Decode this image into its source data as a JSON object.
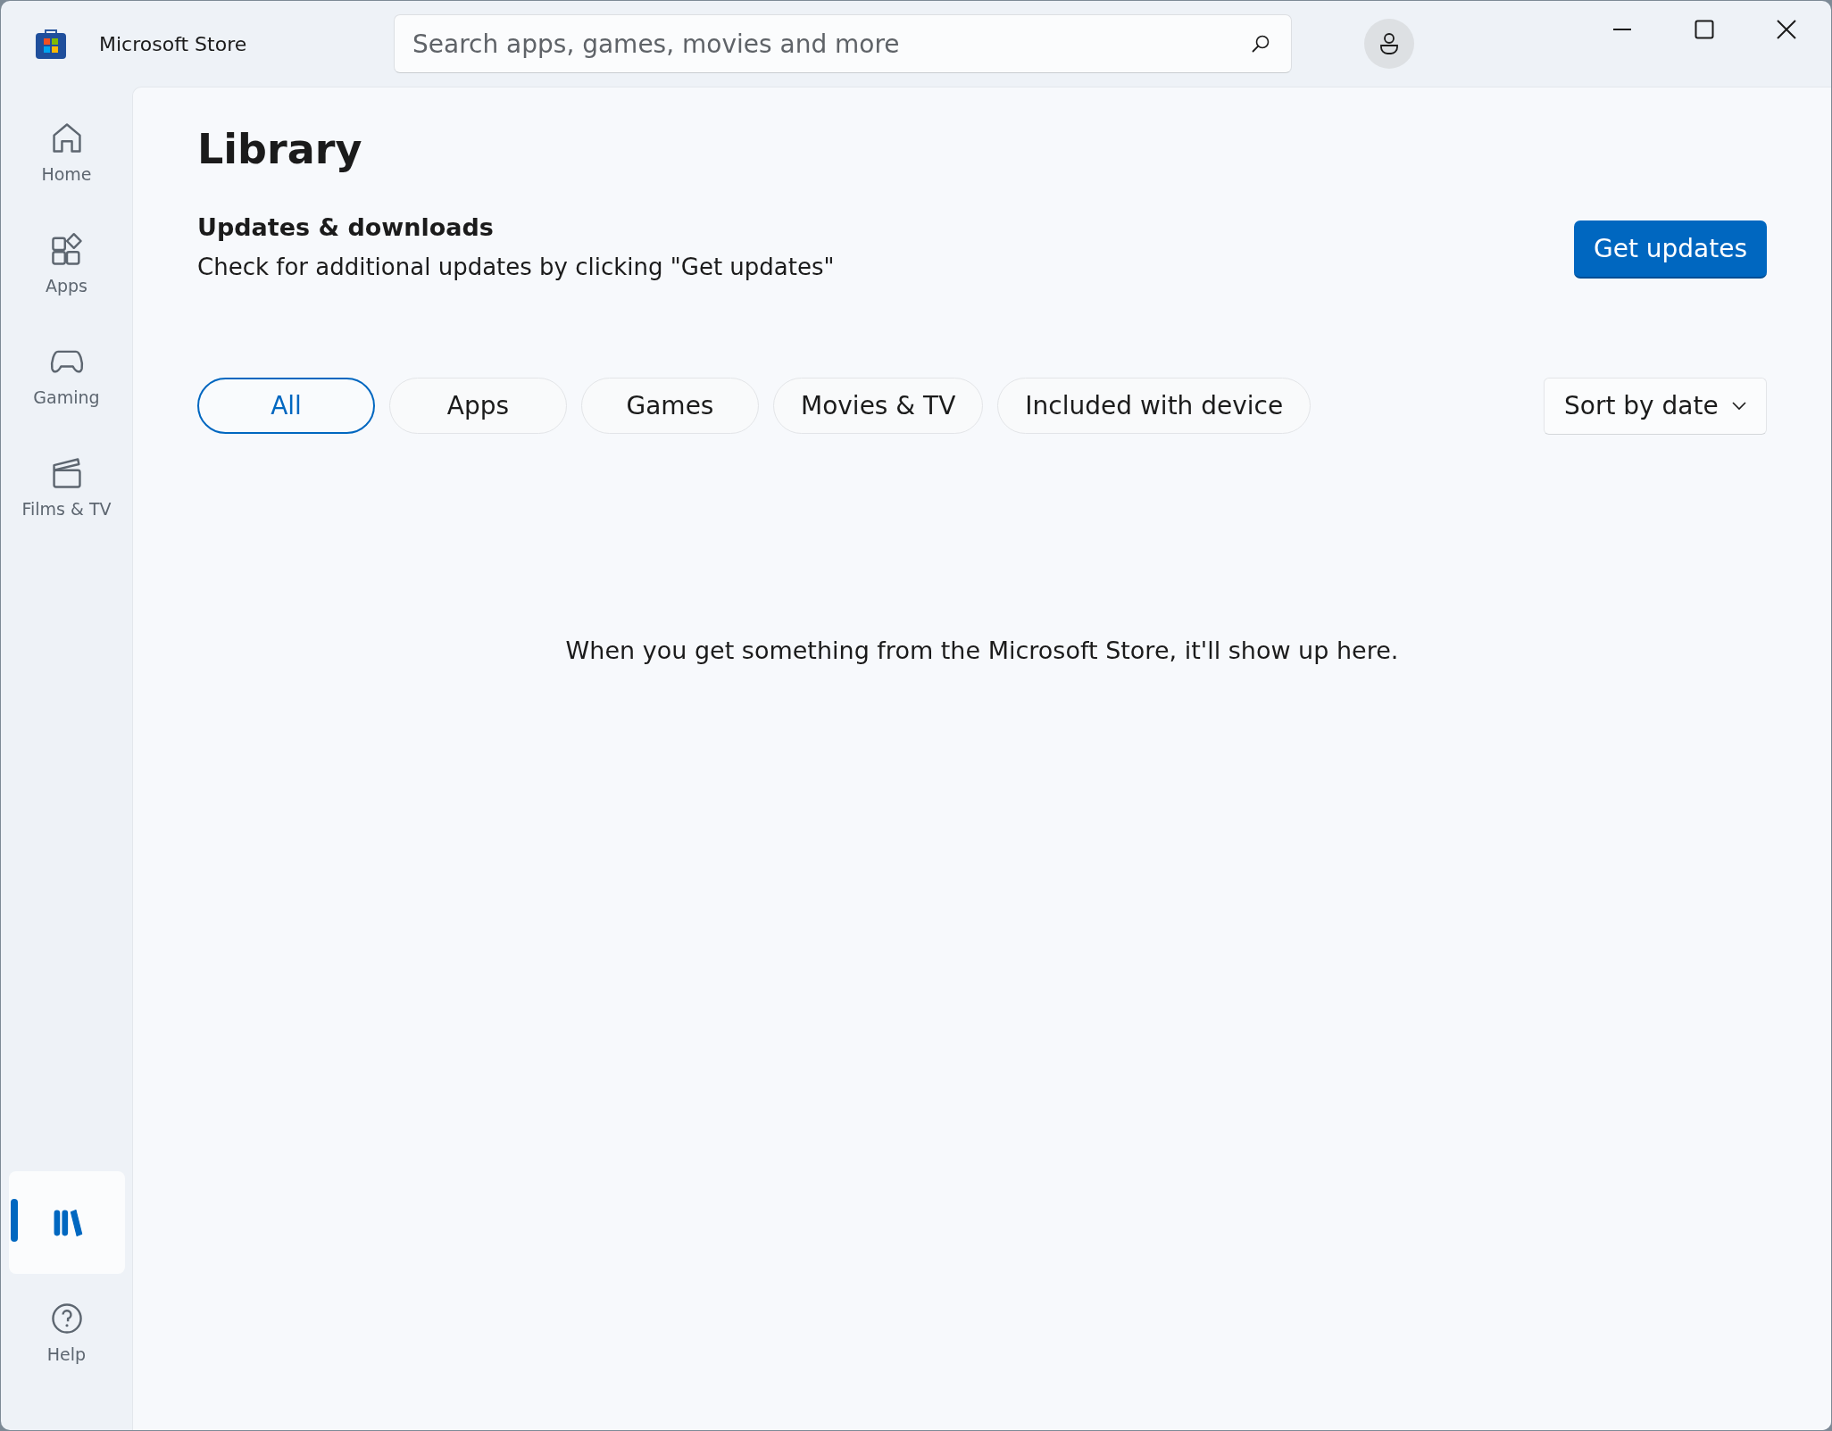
{
  "window": {
    "title": "Microsoft Store"
  },
  "search": {
    "placeholder": "Search apps, games, movies and more"
  },
  "nav": [
    {
      "kind": "home",
      "label": "Home",
      "selected": false
    },
    {
      "kind": "apps",
      "label": "Apps",
      "selected": false
    },
    {
      "kind": "gaming",
      "label": "Gaming",
      "selected": false
    },
    {
      "kind": "films",
      "label": "Films & TV",
      "selected": false
    },
    {
      "kind": "library",
      "selected": true
    },
    {
      "kind": "help",
      "label": "Help",
      "selected": false
    }
  ],
  "page": {
    "title": "Library",
    "section_title": "Updates & downloads",
    "section_text": "Check for additional updates by clicking \"Get updates\"",
    "button": "Get updates"
  },
  "filters": [
    {
      "label": "All",
      "selected": true
    },
    {
      "label": "Apps",
      "selected": false
    },
    {
      "label": "Games",
      "selected": false
    },
    {
      "label": "Movies & TV",
      "selected": false
    },
    {
      "label": "Included with device",
      "selected": false
    }
  ],
  "sort": {
    "label": "Sort by date"
  },
  "empty_message": "When you get something from the Microsoft Store, it'll show up here."
}
